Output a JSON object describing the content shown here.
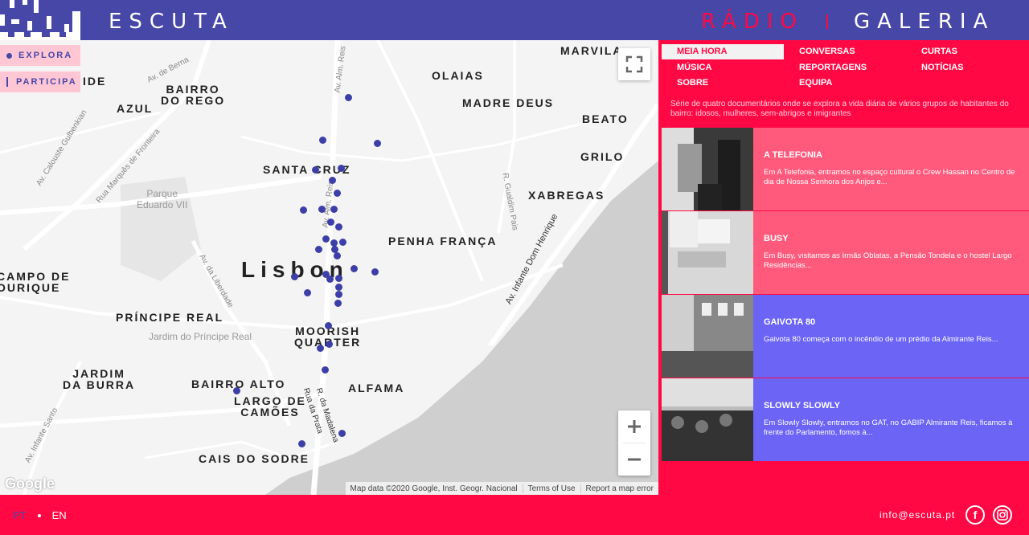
{
  "header": {
    "brand": "ESCUTA",
    "radio": "RÁDIO",
    "galeria": "GALERIA"
  },
  "map": {
    "tabs": {
      "explora": "EXPLORA",
      "participa": "PARTICIPA"
    },
    "city": "Lisbon",
    "places": [
      {
        "id": "marvila",
        "label": "MARVILA"
      },
      {
        "id": "olaias",
        "label": "OLAIAS"
      },
      {
        "id": "madre-deus",
        "label": "MADRE DEUS"
      },
      {
        "id": "beato",
        "label": "BEATO"
      },
      {
        "id": "grilo",
        "label": "GRILO"
      },
      {
        "id": "xabregas",
        "label": "XABREGAS"
      },
      {
        "id": "penha-franca",
        "label": "PENHA FRANÇA"
      },
      {
        "id": "bairro-do-rego",
        "label": "BAIRRO\nDO REGO"
      },
      {
        "id": "azul",
        "label": "AZUL"
      },
      {
        "id": "ide",
        "label": "IDE"
      },
      {
        "id": "santa-cruz",
        "label": "SANTA CRUZ"
      },
      {
        "id": "campo-de-ourique",
        "label": "CAMPO DE\nOURIQUE"
      },
      {
        "id": "principe-real",
        "label": "PRÍNCIPE REAL"
      },
      {
        "id": "moorish-quarter",
        "label": "MOORISH\nQUARTER"
      },
      {
        "id": "jardim-da-burra",
        "label": "JARDIM\nDA BURRA"
      },
      {
        "id": "bairro-alto",
        "label": "BAIRRO ALTO"
      },
      {
        "id": "largo-de-camoes",
        "label": "LARGO DE\nCAMÕES"
      },
      {
        "id": "alfama",
        "label": "ALFAMA"
      },
      {
        "id": "cais-do-sodre",
        "label": "CAIS DO SODRE"
      }
    ],
    "streets": [
      "Av. de Berna",
      "Av. Alm. Reis",
      "Av. Calouste Gulbenkian",
      "Rua Marquês de Fronteira",
      "Av. Alm. Reis",
      "R. Gualdim Pais",
      "Av. Infante Dom Henrique",
      "Av. da Liberdade",
      "R. da Madalena",
      "Rua da Prata",
      "Av. Infante Santo"
    ],
    "parks": [
      "Parque\nEduardo VII",
      "Jardim do Príncipe Real"
    ],
    "google": "Google",
    "attribution": [
      "Map data ©2020 Google, Inst. Geogr. Nacional",
      "Terms of Use",
      "Report a map error"
    ]
  },
  "panel": {
    "menu": [
      {
        "label": "MEIA HORA",
        "active": true
      },
      {
        "label": "CONVERSAS"
      },
      {
        "label": "CURTAS"
      },
      {
        "label": "MÚSICA"
      },
      {
        "label": "REPORTAGENS"
      },
      {
        "label": "NOTÍCIAS"
      },
      {
        "label": "SOBRE"
      },
      {
        "label": "EQUIPA"
      }
    ],
    "description": "Série de quatro documentários onde se explora a vida diária de vários grupos de habitantes do bairro: idosos, mulheres, sem-abrigos e imigrantes",
    "cards": [
      {
        "title": "A TELEFONIA",
        "excerpt": "Em A Telefonia, entramos no espaço cultural o Crew Hassan no Centro de dia de Nossa Senhora dos Anjos e...",
        "color": "#ff5a7c"
      },
      {
        "title": "BUSY",
        "excerpt": "Em Busy, visitamos as Irmãs Oblatas, a Pensão Tondela e o hostel Largo Residências...",
        "color": "#ff5a7c"
      },
      {
        "title": "GAIVOTA 80",
        "excerpt": "Gaivota 80 começa com o incêndio de um prédio da Almirante Reis...",
        "color": "#6b64f5"
      },
      {
        "title": "SLOWLY SLOWLY",
        "excerpt": "Em Slowly Slowly, entramos no GAT, no GABIP Almirante Reis, ficamos à frente do Parlamento, fomos à...",
        "color": "#6b64f5"
      }
    ]
  },
  "footer": {
    "lang_pt": "PT",
    "lang_en": "EN",
    "email": "info@escuta.pt",
    "facebook_icon": "facebook-icon",
    "instagram_icon": "instagram-icon"
  },
  "colors": {
    "header": "#4747a8",
    "accent": "#ff0844",
    "pink_card": "#ff5a7c",
    "violet_card": "#6b64f5",
    "pin": "#3d3fa8"
  }
}
